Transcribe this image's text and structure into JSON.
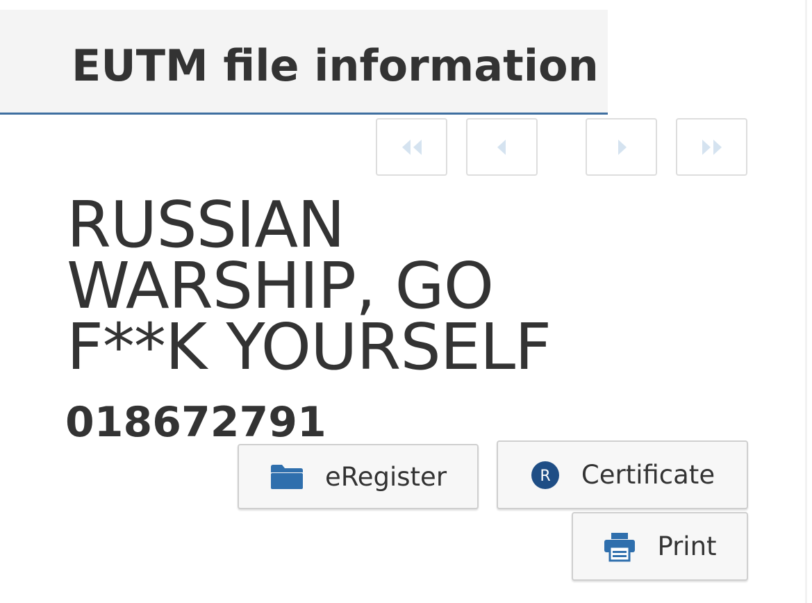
{
  "header": {
    "title": "EUTM file information"
  },
  "navigation": {
    "first_icon": "double-chevron-left-icon",
    "prev_icon": "chevron-left-icon",
    "next_icon": "chevron-right-icon",
    "last_icon": "double-chevron-right-icon"
  },
  "mark": {
    "name_lines": [
      "RUSSIAN",
      "WARSHIP, GO",
      "F**K YOURSELF"
    ],
    "file_number": "018672791"
  },
  "actions": {
    "eregister": {
      "label": "eRegister",
      "icon": "folder-icon"
    },
    "certificate": {
      "label": "Certificate",
      "icon": "registered-icon"
    },
    "print": {
      "label": "Print",
      "icon": "printer-icon"
    }
  },
  "colors": {
    "accent": "#3f6fa0",
    "icon_blue": "#2f6fad",
    "nav_icon": "#d5e3f0",
    "header_bg": "#f4f4f4",
    "text": "#333333"
  }
}
